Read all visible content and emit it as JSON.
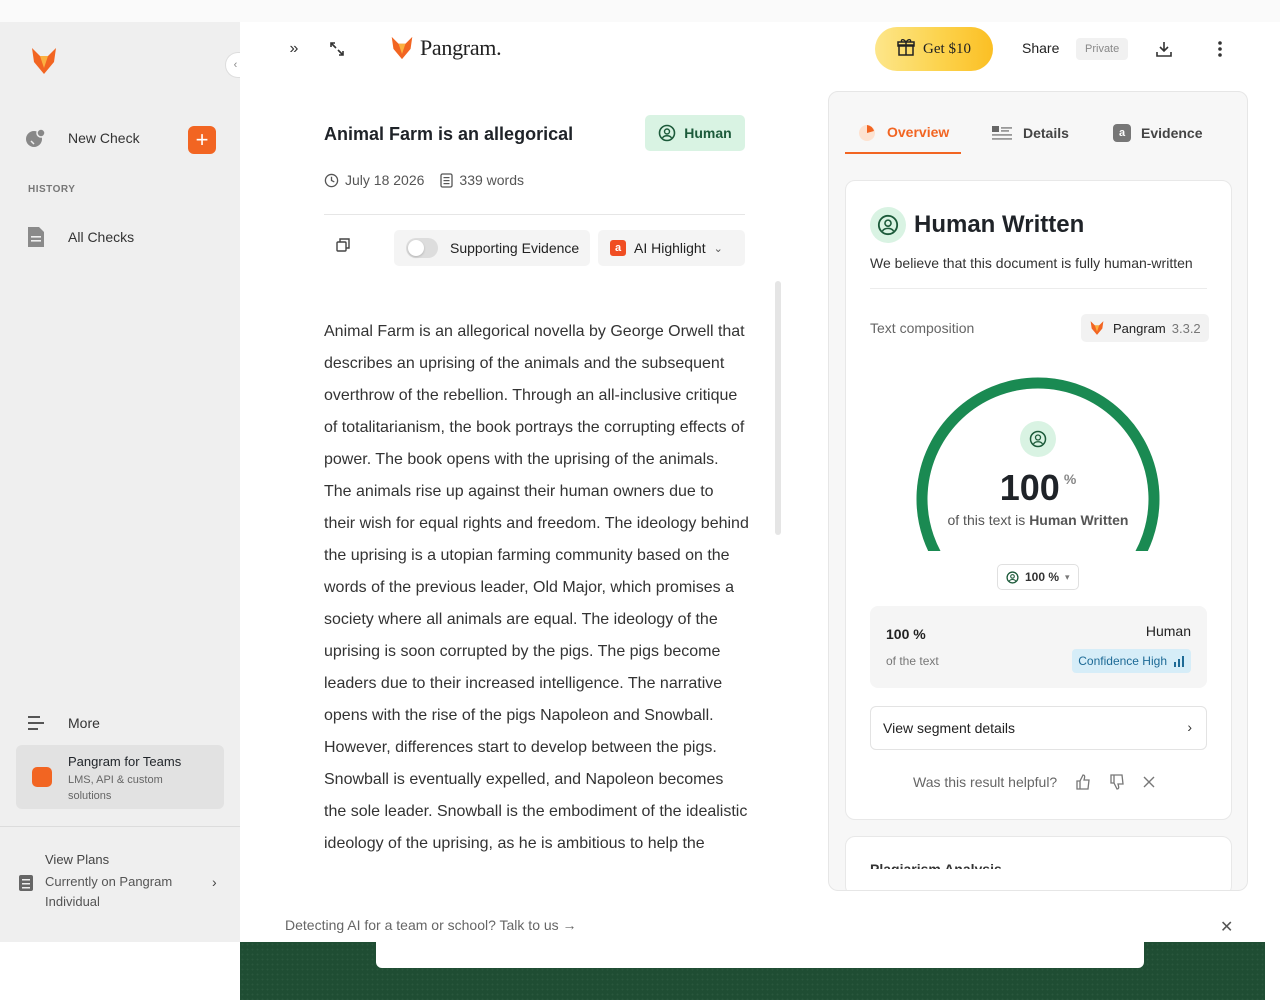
{
  "brand": {
    "name": "Pangram."
  },
  "header": {
    "get_label": "Get $10",
    "share_label": "Share",
    "privacy_label": "Private"
  },
  "sidebar": {
    "new_check_label": "New Check",
    "history_heading": "HISTORY",
    "all_checks_label": "All Checks",
    "more_label": "More",
    "teams_title": "Pangram for Teams",
    "teams_subtitle": "LMS, API & custom solutions",
    "plans_title": "View Plans",
    "plans_subtitle": "Currently on Pangram Individual"
  },
  "document": {
    "title": "Animal Farm is an allegorical",
    "verdict_badge": "Human",
    "date": "July 18 2026",
    "word_count": "339 words",
    "toggle_label": "Supporting Evidence",
    "toggle_on": false,
    "highlight_label": "AI Highlight",
    "body": "Animal Farm is an allegorical novella by George Orwell that describes an uprising of the animals and the subsequent overthrow of the rebellion. Through an all-inclusive critique of totalitarianism, the book portrays the corrupting effects of power. The book opens with the uprising of the animals. The animals rise up against their human owners due to their wish for equal rights and freedom. The ideology behind the uprising is a utopian farming community based on the words of the previous leader, Old Major, which promises a society where all animals are equal. The ideology of the uprising is soon corrupted by the pigs. The pigs become leaders due to their increased intelligence. The narrative opens with the rise of the pigs Napoleon and Snowball. However, differences start to develop between the pigs. Snowball is eventually expelled, and Napoleon becomes the sole leader. Snowball is the embodiment of the idealistic ideology of the uprising, as he is ambitious to help the"
  },
  "panel": {
    "tabs": [
      {
        "label": "Overview",
        "active": true
      },
      {
        "label": "Details",
        "active": false
      },
      {
        "label": "Evidence",
        "active": false
      }
    ],
    "result_title": "Human Written",
    "result_subtitle": "We believe that this document is fully human-written",
    "composition_label": "Text composition",
    "model_name": "Pangram",
    "model_version": "3.3.2",
    "gauge_value": "100",
    "gauge_unit": "%",
    "gauge_fraction": 1.0,
    "gauge_caption_prefix": "of this text is",
    "gauge_caption_emphasis": "Human Written",
    "select_value": "100 %",
    "row_percent": "100 %",
    "row_sub": "of the text",
    "row_label": "Human",
    "confidence_label": "Confidence High",
    "segment_button": "View segment details",
    "feedback_prompt": "Was this result helpful?",
    "next_section_peek": "Plagiarism Analysis"
  },
  "banner": {
    "text": "Detecting AI for a team or school? Talk to us"
  },
  "colors": {
    "accent": "#f26522",
    "human_green": "#1a8a52",
    "human_bg": "#d9f3e3",
    "confidence_bg": "#d6edf8"
  }
}
